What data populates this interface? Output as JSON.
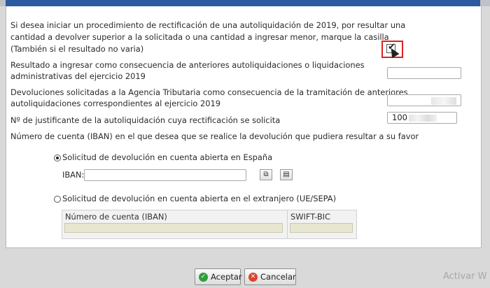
{
  "question_text_1": "Si desea iniciar un procedimiento de rectificación de una autoliquidación de 2019, por resultar una",
  "question_text_2": "cantidad a devolver superior a la solicitada o una cantidad a ingresar menor, marque la casilla",
  "question_text_3": "(También si el resultado no varia)",
  "checkbox_checked": true,
  "resultado_label_1": "Resultado a ingresar como consecuencia de anteriores autoliquidaciones o liquidaciones",
  "resultado_label_2": "administrativas del ejercicio 2019",
  "resultado_value": "",
  "devoluciones_label_1": "Devoluciones solicitadas a la Agencia Tributaria como consecuencia de la tramitación de anteriores",
  "devoluciones_label_2": "autoliquidaciones correspondientes al ejercicio 2019",
  "justificante_label": "Nº de justificante de la autoliquidación cuya rectificación se solicita",
  "justificante_value": "100",
  "cuenta_label": "Número de cuenta (IBAN) en el que desea que se realice la devolución que pudiera resultar a su favor",
  "option_espana": "Solicitud de devolución en cuenta abierta en España",
  "iban_label": "IBAN:",
  "iban_value": "",
  "option_extranjero": "Solicitud de devolución en cuenta abierta en el extranjero (UE/SEPA)",
  "col_numero_cuenta": "Número de cuenta (IBAN)",
  "col_swift": "SWIFT-BIC",
  "aceptar_label": "Aceptar",
  "cancelar_label": "Cancelar",
  "watermark_text": "Activar W",
  "icons": {
    "copy": "copy-icon",
    "paste": "paste-icon",
    "accept": "check-circle-icon",
    "cancel": "x-circle-icon"
  },
  "colors": {
    "accent_red": "#e02020",
    "title_blue": "#2c5aa0",
    "accept_green": "#2f9e3a",
    "cancel_red": "#d9442e",
    "disabled_input": "#e8e6cf"
  }
}
